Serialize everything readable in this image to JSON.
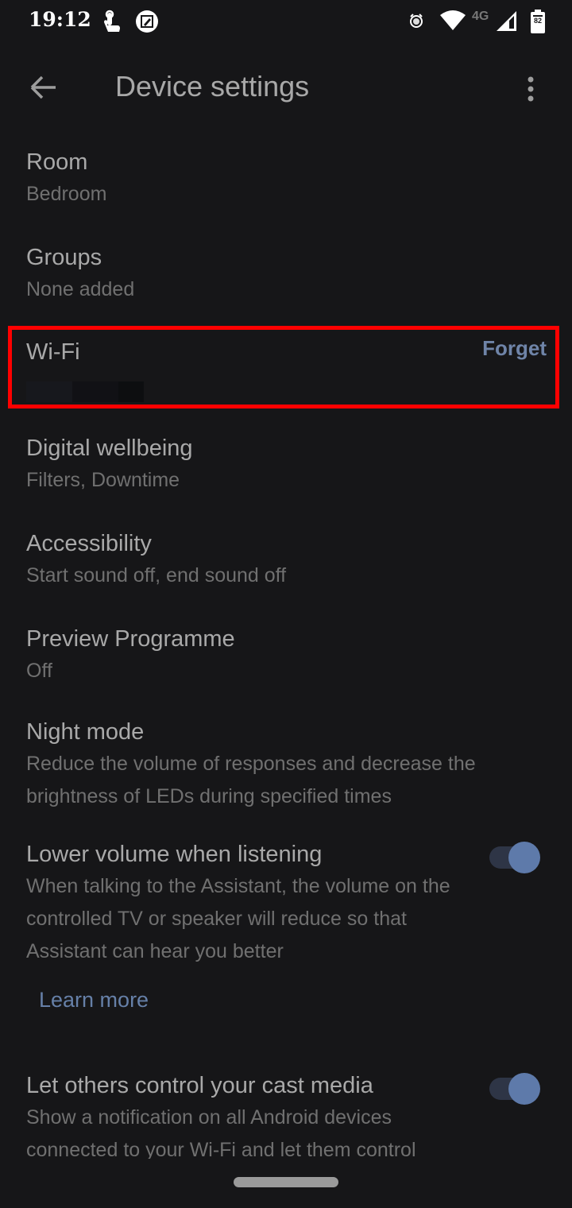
{
  "status_bar": {
    "time": "19:12",
    "icons": [
      "touch-gesture-icon",
      "screenshot-edit-icon",
      "alarm-icon",
      "wifi-icon",
      "signal-icon",
      "battery-icon"
    ],
    "network_label": "4G",
    "battery_level": "82"
  },
  "app_bar": {
    "title": "Device settings",
    "back_icon": "arrow-back-icon",
    "menu_icon": "more-vert-icon"
  },
  "settings": [
    {
      "title": "Room",
      "subtitle": "Bedroom"
    },
    {
      "title": "Groups",
      "subtitle": "None added"
    },
    {
      "title": "Wi-Fi",
      "subtitle": "",
      "action": "Forget"
    },
    {
      "title": "Digital wellbeing",
      "subtitle": "Filters, Downtime"
    },
    {
      "title": "Accessibility",
      "subtitle": "Start sound off, end sound off"
    },
    {
      "title": "Preview Programme",
      "subtitle": "Off"
    },
    {
      "title": "Night mode",
      "subtitle": "Reduce the volume of responses and decrease the brightness of LEDs during specified times"
    },
    {
      "title": "Lower volume when listening",
      "subtitle": "When talking to the Assistant, the volume on the controlled TV or speaker will reduce so that Assistant can hear you better",
      "toggle": true,
      "link": "Learn more"
    },
    {
      "title": "Let others control your cast media",
      "subtitle": "Show a notification on all Android devices connected to your Wi-Fi and let them control",
      "toggle": true
    }
  ],
  "colors": {
    "background": "#161618",
    "accent": "#6f84a8",
    "highlight": "#ff0000",
    "toggle_thumb": "#5e7aaa",
    "toggle_track": "#2e3546"
  }
}
